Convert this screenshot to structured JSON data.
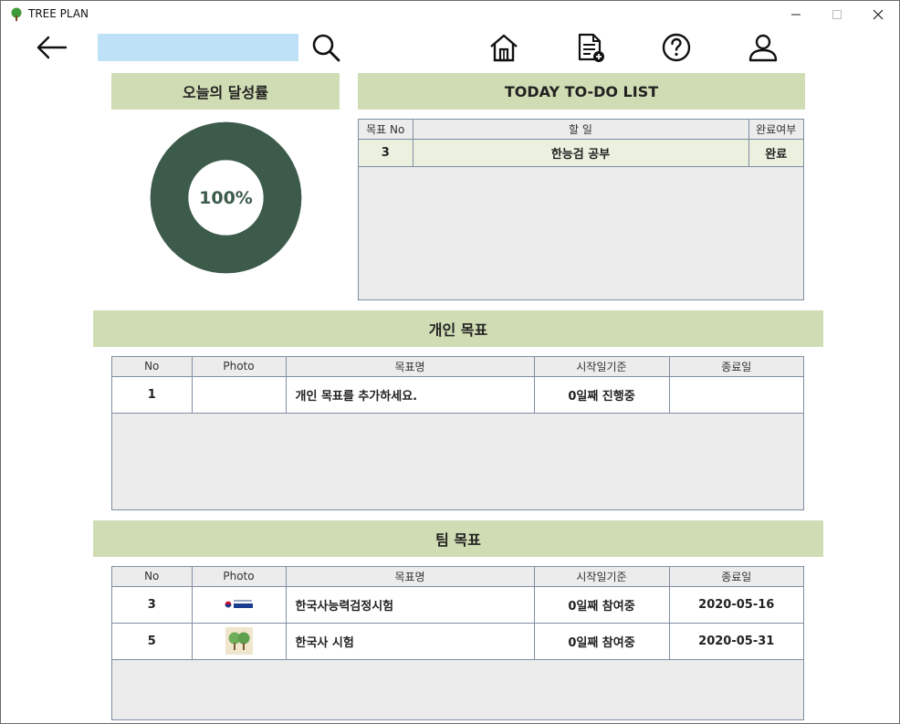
{
  "window": {
    "title": "TREE PLAN"
  },
  "search": {
    "value": "",
    "placeholder": ""
  },
  "sections": {
    "achievement": "오늘의 달성률",
    "todo": "TODAY TO-DO LIST",
    "personal": "개인 목표",
    "team": "팀 목표"
  },
  "achievement": {
    "percent": 100,
    "label": "100%",
    "fill_color": "#3d5b4b",
    "track_color": "#3d5b4b"
  },
  "todo_table": {
    "columns": [
      "목표 No",
      "할 일",
      "완료여부"
    ],
    "rows": [
      {
        "no": "3",
        "task": "한능검 공부",
        "done": "완료"
      }
    ]
  },
  "personal_table": {
    "columns": [
      "No",
      "Photo",
      "목표명",
      "시작일기준",
      "종료일"
    ],
    "rows": [
      {
        "no": "1",
        "photo": "",
        "name": "개인 목표를 추가하세요.",
        "since": "0일째 진행중",
        "end": ""
      }
    ]
  },
  "team_table": {
    "columns": [
      "No",
      "Photo",
      "목표명",
      "시작일기준",
      "종료일"
    ],
    "rows": [
      {
        "no": "3",
        "photo": "korean-history-exam-logo",
        "name": "한국사능력검정시험",
        "since": "0일째 참여중",
        "end": "2020-05-16"
      },
      {
        "no": "5",
        "photo": "tree-image",
        "name": "한국사 시험",
        "since": "0일째 참여중",
        "end": "2020-05-31"
      }
    ]
  },
  "colors": {
    "section_bg": "#d0ddb4",
    "search_bg": "#bfe1f7",
    "accent_dark": "#3d5b4b"
  }
}
